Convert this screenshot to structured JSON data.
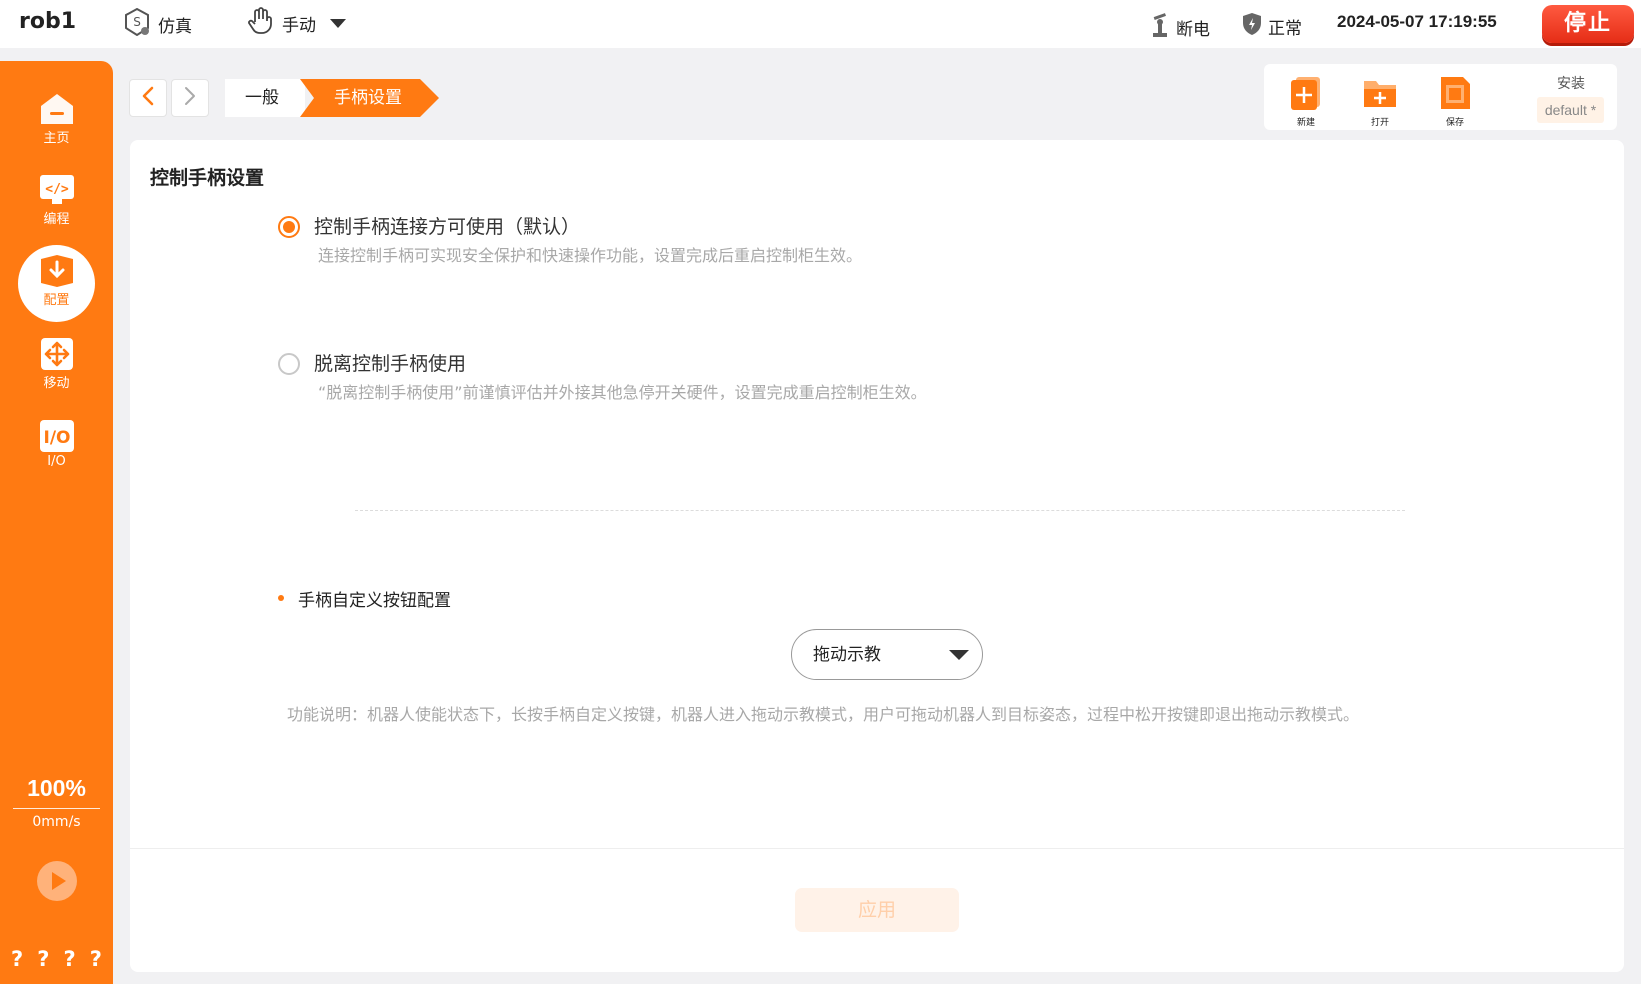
{
  "topbar": {
    "robot_name": "rob1",
    "sim_label": "仿真",
    "mode_label": "手动",
    "power_status": "断电",
    "safety_status": "正常",
    "datetime": "2024-05-07 17:19:55",
    "stop_label": "停止"
  },
  "sidebar": {
    "items": [
      {
        "label": "主页",
        "icon": "home-icon"
      },
      {
        "label": "编程",
        "icon": "code-icon"
      },
      {
        "label": "配置",
        "icon": "config-icon"
      },
      {
        "label": "移动",
        "icon": "move-icon"
      },
      {
        "label": "I/O",
        "icon": "io-icon"
      }
    ],
    "active_item": "配置",
    "speed_percent": "100%",
    "speed_unit": "0mm/s",
    "unknown_glyphs": [
      "?",
      "?",
      "?",
      "?"
    ]
  },
  "breadcrumb": {
    "general": "一般",
    "current": "手柄设置"
  },
  "file_toolbar": {
    "new_label": "新建",
    "open_label": "打开",
    "save_label": "保存",
    "install_label": "安装",
    "config_name": "default *"
  },
  "panel": {
    "title": "控制手柄设置",
    "options": [
      {
        "label": "控制手柄连接方可使用（默认）",
        "desc": "连接控制手柄可实现安全保护和快速操作功能，设置完成后重启控制柜生效。",
        "checked": true
      },
      {
        "label": "脱离控制手柄使用",
        "desc": "“脱离控制手柄使用”前谨慎评估并外接其他急停开关硬件，设置完成重启控制柜生效。",
        "checked": false
      }
    ],
    "custom_button_section": "手柄自定义按钮配置",
    "custom_button_value": "拖动示教",
    "function_desc": "功能说明：机器人使能状态下，长按手柄自定义按键，机器人进入拖动示教模式，用户可拖动机器人到目标姿态，过程中松开按键即退出拖动示教模式。",
    "apply_label": "应用"
  },
  "colors": {
    "accent": "#ff7a12",
    "stop": "#e52d16",
    "page_bg": "#f1f1f3"
  }
}
